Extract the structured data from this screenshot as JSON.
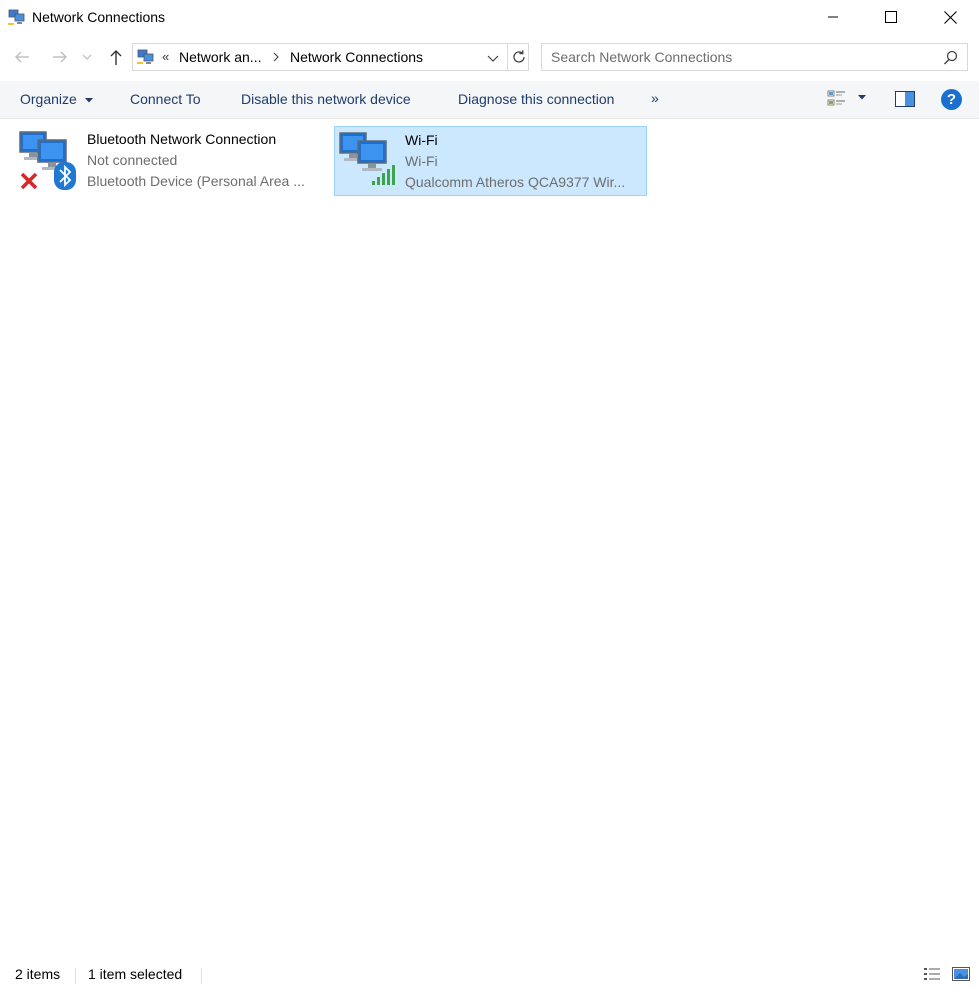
{
  "window": {
    "title": "Network Connections",
    "icon": "network-connections-icon"
  },
  "nav": {
    "back_icon": "arrow-left-icon",
    "forward_icon": "arrow-right-icon",
    "recent_icon": "chevron-down-icon",
    "up_icon": "arrow-up-icon"
  },
  "address": {
    "overflow": "«",
    "segments": [
      "Network an...",
      "Network Connections"
    ],
    "refresh_icon": "refresh-icon"
  },
  "search": {
    "placeholder": "Search Network Connections"
  },
  "commands": {
    "organize": "Organize",
    "connect_to": "Connect To",
    "disable": "Disable this network device",
    "diagnose": "Diagnose this connection",
    "more": "»"
  },
  "connections": [
    {
      "name": "Bluetooth Network Connection",
      "status": "Not connected",
      "device": "Bluetooth Device (Personal Area ...",
      "selected": false,
      "badge": "bluetooth-icon",
      "state_icon": "disconnected-x-icon"
    },
    {
      "name": "Wi-Fi",
      "status": "Wi-Fi",
      "device": "Qualcomm Atheros QCA9377 Wir...",
      "selected": true,
      "badge": "signal-bars-icon"
    }
  ],
  "status": {
    "item_count": "2 items",
    "selection": "1 item selected"
  },
  "colors": {
    "selection_bg": "#cce8ff",
    "selection_border": "#99d1ff",
    "command_text": "#1e3c6c",
    "help_blue": "#1a6fd0",
    "secondary_text": "#6d6d6d"
  }
}
